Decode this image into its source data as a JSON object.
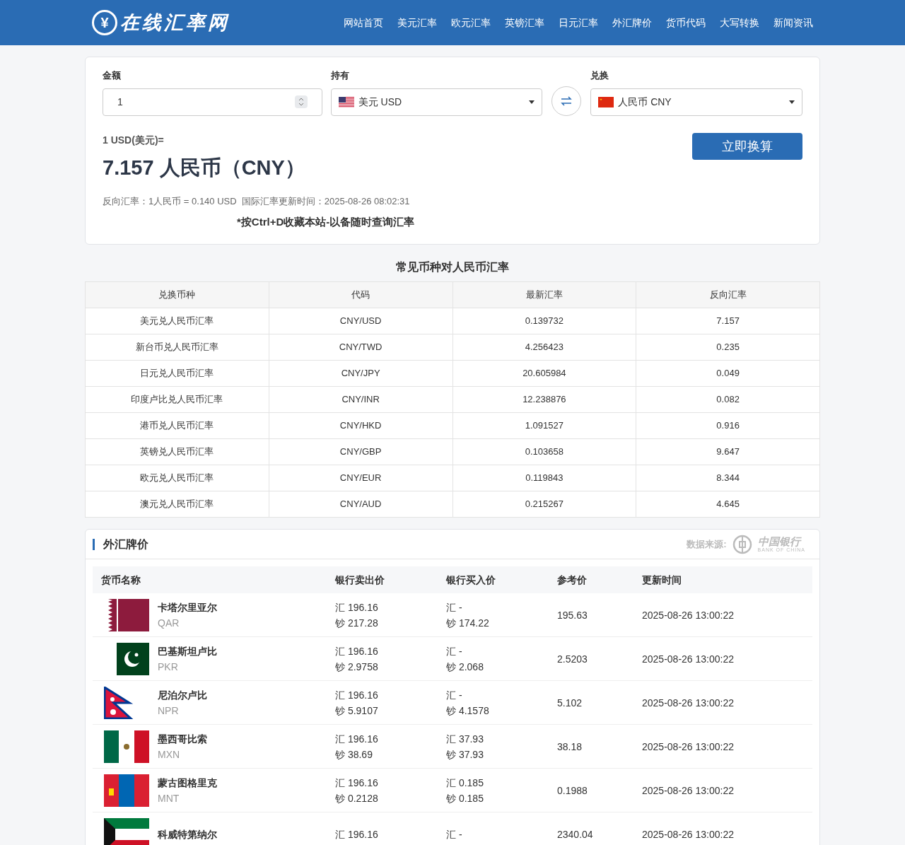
{
  "header": {
    "logo_symbol": "¥",
    "logo_text": "在线汇率网",
    "nav": [
      {
        "label": "网站首页"
      },
      {
        "label": "美元汇率"
      },
      {
        "label": "欧元汇率"
      },
      {
        "label": "英镑汇率"
      },
      {
        "label": "日元汇率"
      },
      {
        "label": "外汇牌价"
      },
      {
        "label": "货币代码"
      },
      {
        "label": "大写转换"
      },
      {
        "label": "新闻资讯"
      }
    ]
  },
  "converter": {
    "amount_label": "金额",
    "amount_value": "1",
    "from_label": "持有",
    "from": {
      "kind": "us",
      "text": "美元 USD"
    },
    "to_label": "兑换",
    "to": {
      "kind": "cn",
      "text": "人民币 CNY"
    },
    "button": "立即换算",
    "result_prefix": "1 USD(美元)=",
    "result": "7.157 人民币（CNY）",
    "inverse": "反向汇率：1人民币 = 0.140 USD  国际汇率更新时间：2025-08-26 08:02:31",
    "tip": "*按Ctrl+D收藏本站-以备随时查询汇率"
  },
  "rates_table": {
    "title": "常见币种对人民币汇率",
    "columns": [
      "兑换币种",
      "代码",
      "最新汇率",
      "反向汇率"
    ],
    "rows": [
      [
        "美元兑人民币汇率",
        "CNY/USD",
        "0.139732",
        "7.157"
      ],
      [
        "新台币兑人民币汇率",
        "CNY/TWD",
        "4.256423",
        "0.235"
      ],
      [
        "日元兑人民币汇率",
        "CNY/JPY",
        "20.605984",
        "0.049"
      ],
      [
        "印度卢比兑人民币汇率",
        "CNY/INR",
        "12.238876",
        "0.082"
      ],
      [
        "港币兑人民币汇率",
        "CNY/HKD",
        "1.091527",
        "0.916"
      ],
      [
        "英镑兑人民币汇率",
        "CNY/GBP",
        "0.103658",
        "9.647"
      ],
      [
        "欧元兑人民币汇率",
        "CNY/EUR",
        "0.119843",
        "8.344"
      ],
      [
        "澳元兑人民币汇率",
        "CNY/AUD",
        "0.215267",
        "4.645"
      ]
    ]
  },
  "forex": {
    "title": "外汇牌价",
    "source_label": "数据来源:",
    "source_logo_cn": "中国银行",
    "source_logo_en": "BANK OF CHINA",
    "columns": [
      "货币名称",
      "银行卖出价",
      "银行买入价",
      "参考价",
      "更新时间"
    ],
    "rows": [
      {
        "kind": "qatar",
        "name": "卡塔尔里亚尔",
        "code": "QAR",
        "sell": [
          "汇 196.16",
          "钞 217.28"
        ],
        "buy": [
          "汇 -",
          "钞 174.22"
        ],
        "ref": "195.63",
        "time": "2025-08-26 13:00:22"
      },
      {
        "kind": "pakistan",
        "name": "巴基斯坦卢比",
        "code": "PKR",
        "sell": [
          "汇 196.16",
          "钞 2.9758"
        ],
        "buy": [
          "汇 -",
          "钞 2.068"
        ],
        "ref": "2.5203",
        "time": "2025-08-26 13:00:22"
      },
      {
        "kind": "nepal",
        "name": "尼泊尔卢比",
        "code": "NPR",
        "sell": [
          "汇 196.16",
          "钞 5.9107"
        ],
        "buy": [
          "汇 -",
          "钞 4.1578"
        ],
        "ref": "5.102",
        "time": "2025-08-26 13:00:22"
      },
      {
        "kind": "mexico",
        "name": "墨西哥比索",
        "code": "MXN",
        "sell": [
          "汇 196.16",
          "钞 38.69"
        ],
        "buy": [
          "汇 37.93",
          "钞 37.93"
        ],
        "ref": "38.18",
        "time": "2025-08-26 13:00:22"
      },
      {
        "kind": "mongolia",
        "name": "蒙古图格里克",
        "code": "MNT",
        "sell": [
          "汇 196.16",
          "钞 0.2128"
        ],
        "buy": [
          "汇 0.185",
          "钞 0.185"
        ],
        "ref": "0.1988",
        "time": "2025-08-26 13:00:22"
      },
      {
        "kind": "kuwait",
        "name": "科威特第纳尔",
        "sell": [
          "汇 196.16"
        ],
        "buy": [
          "汇 -"
        ],
        "ref": "2340.04",
        "time": "2025-08-26 13:00:22"
      }
    ]
  }
}
